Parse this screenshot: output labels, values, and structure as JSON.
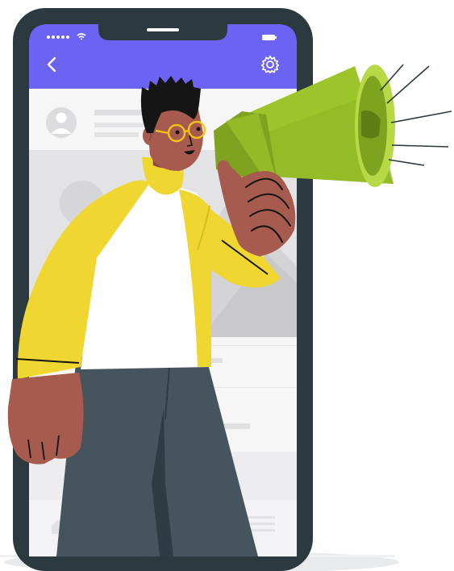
{
  "scene": {
    "description_type": "illustration",
    "subject": "man-with-megaphone-emerging-from-phone"
  },
  "phone": {
    "top_bar": {
      "back_icon": "chevron-left-icon",
      "settings_icon": "gear-icon"
    },
    "status_bar": {
      "signal_icon": "signal-dots-icon",
      "wifi_icon": "wifi-icon",
      "battery_icon": "battery-icon"
    }
  },
  "colors": {
    "background": "#ffffff",
    "ground_shadow": "#e9eaec",
    "phone_frame": "#2c3a40",
    "screen_bg": "#f6f6f7",
    "top_bar": "#6c63f5",
    "placeholder_gray": "#e3e3e5",
    "placeholder_dark": "#d2d2d5",
    "skin": "#a65b4e",
    "skin_shadow": "#8e4a3f",
    "hair": "#151515",
    "shirt_white": "#ffffff",
    "jacket_yellow": "#f0d630",
    "pants": "#45545d",
    "pants_dark": "#303c43",
    "glasses": "#f3c21a",
    "megaphone_green": "#9ec42c",
    "megaphone_dark": "#7fa21f",
    "megaphone_light": "#b7d847",
    "sound_lines": "#2c3a40"
  }
}
